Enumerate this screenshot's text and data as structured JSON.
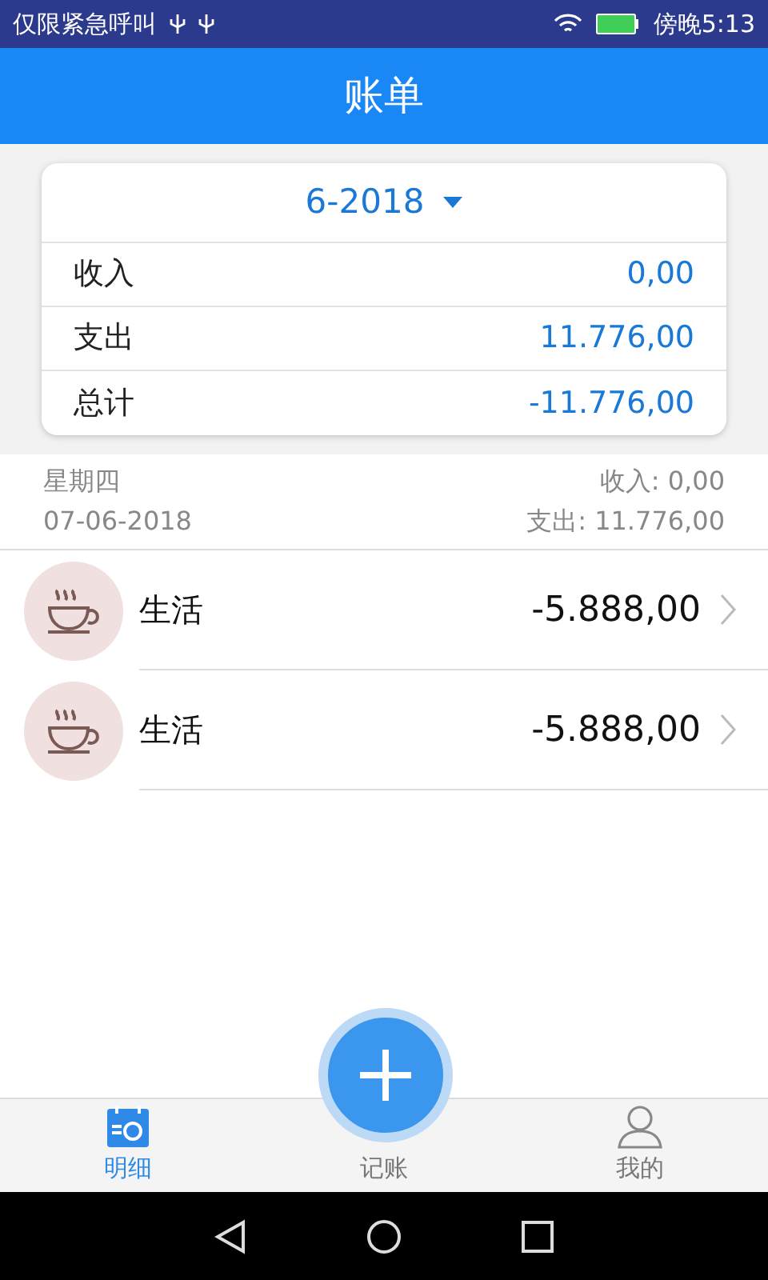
{
  "status_bar": {
    "carrier": "仅限紧急呼叫",
    "time": "傍晚5:13"
  },
  "title": "账单",
  "summary": {
    "period": "6-2018",
    "rows": [
      {
        "label": "收入",
        "value": "0,00"
      },
      {
        "label": "支出",
        "value": "11.776,00"
      },
      {
        "label": "总计",
        "value": "-11.776,00"
      }
    ]
  },
  "day": {
    "weekday": "星期四",
    "date": "07-06-2018",
    "income": "收入: 0,00",
    "expense": "支出: 11.776,00"
  },
  "entries": [
    {
      "category": "生活",
      "amount": "-5.888,00"
    },
    {
      "category": "生活",
      "amount": "-5.888,00"
    }
  ],
  "tabs": [
    {
      "kind": "list",
      "label": "明细",
      "selected": true
    },
    {
      "kind": "add",
      "label": "记账",
      "selected": false
    },
    {
      "kind": "profile",
      "label": "我的",
      "selected": false
    }
  ]
}
